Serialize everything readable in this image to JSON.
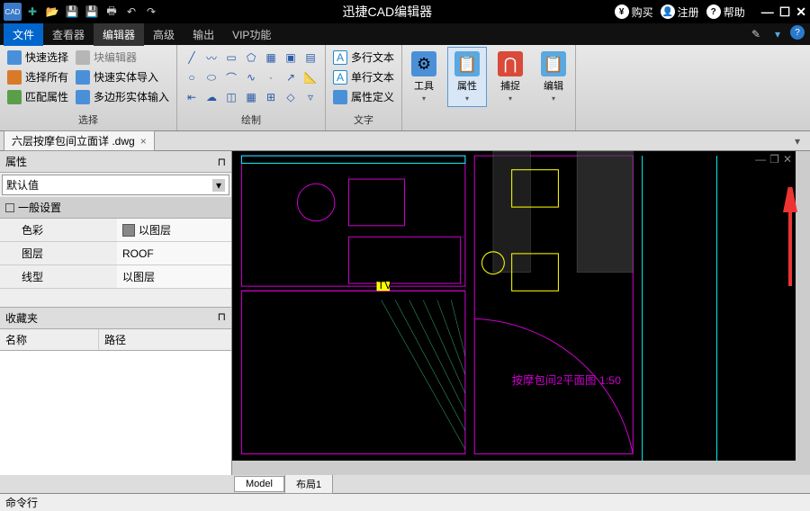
{
  "titlebar": {
    "title": "迅捷CAD编辑器",
    "buy": "购买",
    "register": "注册",
    "help": "帮助"
  },
  "menu": {
    "file": "文件",
    "viewer": "查看器",
    "editor": "编辑器",
    "advanced": "高级",
    "output": "输出",
    "vip": "VIP功能"
  },
  "ribbon": {
    "select": {
      "quick": "快速选择",
      "all": "选择所有",
      "match": "匹配属性",
      "blockedit": "块编辑器",
      "solidimport": "快速实体导入",
      "polysolid": "多边形实体输入",
      "label": "选择"
    },
    "draw_label": "绘制",
    "text": {
      "multi": "多行文本",
      "single": "单行文本",
      "attrdef": "属性定义",
      "label": "文字"
    },
    "tools": "工具",
    "props": "属性",
    "snap": "捕捉",
    "edit": "编辑"
  },
  "doc": {
    "name": "六层按摩包间立面详 .dwg"
  },
  "sidebar": {
    "props_title": "属性",
    "default_val": "默认值",
    "general": "一般设置",
    "rows": {
      "color_k": "色彩",
      "color_v": "以图层",
      "layer_k": "图层",
      "layer_v": "ROOF",
      "ltype_k": "线型",
      "ltype_v": "以图层"
    },
    "fav_title": "收藏夹",
    "fav_name": "名称",
    "fav_path": "路径"
  },
  "tabs": {
    "model": "Model",
    "layout1": "布局1"
  },
  "cmd": {
    "label": "命令行"
  },
  "cad_text": {
    "note1": "按摩包间2平面图 1:50"
  }
}
